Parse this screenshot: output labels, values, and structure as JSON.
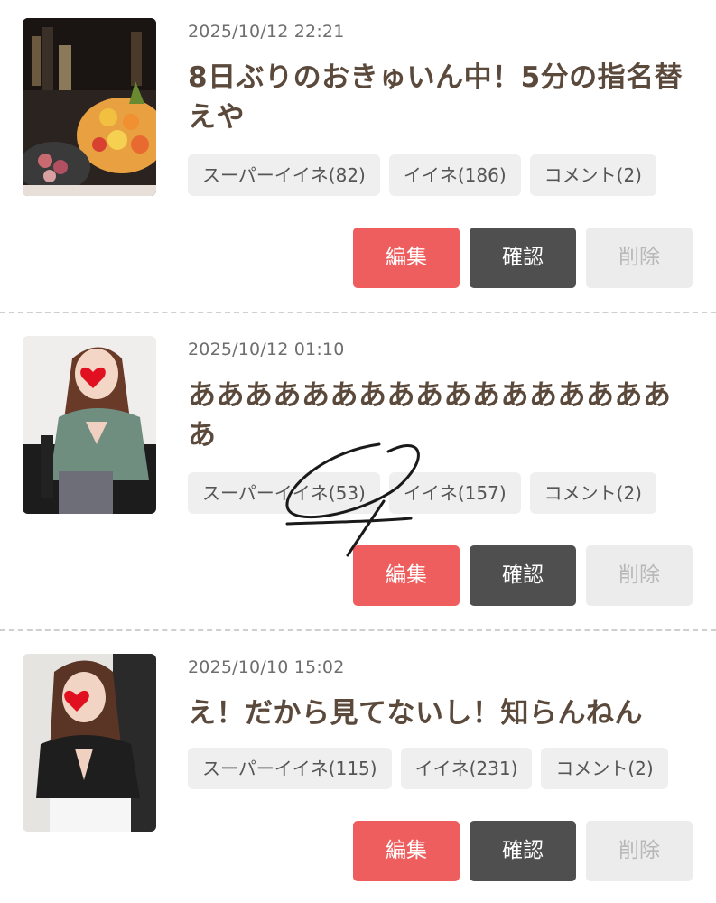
{
  "posts": [
    {
      "date": "2025/10/12 22:21",
      "title": "8日ぶりのおきゅいん中！5分の指名替えや",
      "thumbnail": "fruit-platter-photo",
      "super_like": "スーパーイイネ(82)",
      "like": "イイネ(186)",
      "comment": "コメント(2)"
    },
    {
      "date": "2025/10/12 01:10",
      "title": "ああああああああああああああああああ",
      "thumbnail": "woman-green-top-photo",
      "super_like": "スーパーイイネ(53)",
      "like": "イイネ(157)",
      "comment": "コメント(2)"
    },
    {
      "date": "2025/10/10 15:02",
      "title": "え！だから見てないし！知らんねん",
      "thumbnail": "woman-black-top-photo",
      "super_like": "スーパーイイネ(115)",
      "like": "イイネ(231)",
      "comment": "コメント(2)"
    }
  ],
  "actions": {
    "edit_label": "編集",
    "confirm_label": "確認",
    "delete_label": "削除"
  },
  "colors": {
    "edit": "#ee5e5e",
    "confirm": "#4f4f4f",
    "delete": "#ececec",
    "title": "#5b4a3c",
    "chip": "#efefef"
  }
}
